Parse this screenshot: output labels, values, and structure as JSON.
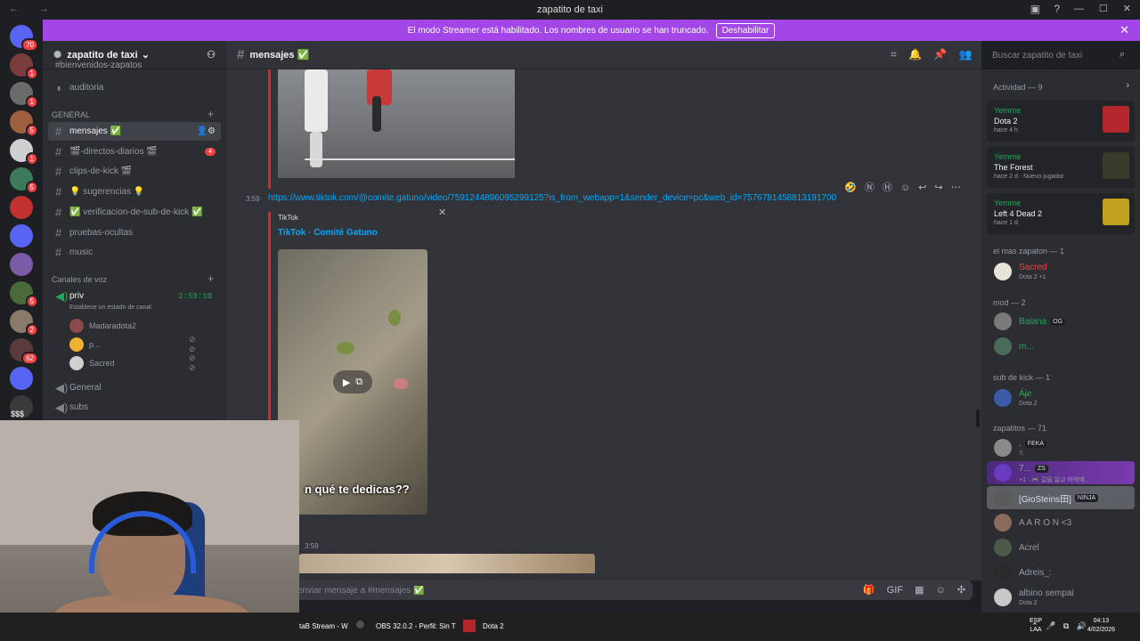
{
  "window": {
    "title": "zapatito de taxi",
    "nav": "← →"
  },
  "banner": {
    "text": "El modo Streamer está habilitado. Los nombres de usuario se han truncado.",
    "button": "Deshabilitar"
  },
  "servers": [
    {
      "badge": "70",
      "color": "#5865f2"
    },
    {
      "badge": "1",
      "color": "#7a3b3b"
    },
    {
      "badge": "1",
      "color": "#6b6b6b"
    },
    {
      "badge": "5",
      "color": "#a06040"
    },
    {
      "badge": "1",
      "color": "#cfcfcf"
    },
    {
      "badge": "5",
      "color": "#3b7a5a"
    },
    {
      "badge": "",
      "color": "#c23030"
    },
    {
      "badge": "",
      "color": "#5865f2"
    },
    {
      "badge": "",
      "color": "#7b5aa6"
    },
    {
      "badge": "5",
      "color": "#4a6a3a"
    },
    {
      "badge": "2",
      "color": "#8a7a6a"
    },
    {
      "badge": "62",
      "color": "#5a3a3a"
    },
    {
      "badge": "",
      "color": "#5865f2"
    },
    {
      "badge": "",
      "color": "#3a3a3a"
    }
  ],
  "server_extra": "$$$",
  "guild": {
    "name": "zapatito de taxi"
  },
  "channels": {
    "top_partial": "#bienvenidos-zapatos",
    "auditoria": "auditoria",
    "cat_general": "GENERAL",
    "items": [
      {
        "label": "mensajes ✅",
        "active": true
      },
      {
        "label": "🎬-directos-diarios 🎬",
        "badge": "4"
      },
      {
        "label": "clips-de-kick 🎬"
      },
      {
        "label": "💡 sugerencias 💡"
      },
      {
        "label": "✅ verificacion-de-sub-de-kick ✅"
      },
      {
        "label": "pruebas-ocultas"
      },
      {
        "label": "music"
      }
    ],
    "cat_voz": "Canales de voz",
    "voice_channel": "priv",
    "voice_time": "2:59:10",
    "voice_status": "Establece un estado de canal",
    "voice_users": [
      "Madaradota2",
      "p...",
      "Sacred"
    ],
    "voice_general": "General",
    "voice_subs": "subs"
  },
  "chat": {
    "channel": "mensajes ✅",
    "search_placeholder": "Buscar zapatito de taxi",
    "time1": "3:59",
    "link": "https://www.tiktok.com/@comite.gatuno/video/7591244896095299125?is_from_webapp=1&sender_device=pc&web_id=7576781458813191700",
    "embed_source": "TikTok",
    "embed_title": "TikTok · Comité Gatuno",
    "video_caption": "n qué te dedicas??",
    "time2": "3:59",
    "composer_placeholder": "enviar mensaje a #mensajes ✅"
  },
  "members": {
    "activity_header": "Actividad — 9",
    "activities": [
      {
        "user": "Yemme",
        "game": "Dota 2",
        "when": "hace 4 h",
        "thumb": "#b3262b"
      },
      {
        "user": "Yemme",
        "game": "The Forest",
        "when": "hace 2 d  ·  Nuevo jugador",
        "thumb": "#3a3a2a"
      },
      {
        "user": "Yemme",
        "game": "Left 4 Dead 2",
        "when": "hace 1 d",
        "thumb": "#c0a020"
      }
    ],
    "cat_mas": "el mas zapaton — 1",
    "sacred": {
      "name": "Sacred",
      "sub": "Dota 2 +1"
    },
    "cat_mod": "mod — 2",
    "mods": [
      {
        "name": "Baiana",
        "tag": "OG"
      },
      {
        "name": "m..."
      }
    ],
    "cat_sub": "sub de kick — 1",
    "sub_member": {
      "name": "Áj̶e",
      "sub": "Dota 2"
    },
    "cat_zapatitos": "zapatitos — 71",
    "zapatitos": [
      {
        "name": ".",
        "tag": "FEKA",
        "sub": "7ᵢ"
      },
      {
        "name": "7...",
        "tag": "ZS",
        "sub": "+1 · 🎮 길을 잃고 마약에..."
      },
      {
        "name": "[GioSteins田]",
        "tag": "NINJA"
      },
      {
        "name": "A A R O N <3"
      },
      {
        "name": "Acrel"
      },
      {
        "name": "Adreis_:"
      },
      {
        "name": "albino sempai",
        "sub": "Dota 2"
      }
    ]
  },
  "taskbar": {
    "items": [
      "taB Stream - W",
      "OBS 32.0.2 - Perfil: Sin T",
      "Dota 2"
    ],
    "lang": "ESP\nLAA",
    "time": "04:13",
    "date": "4/02/2026"
  }
}
